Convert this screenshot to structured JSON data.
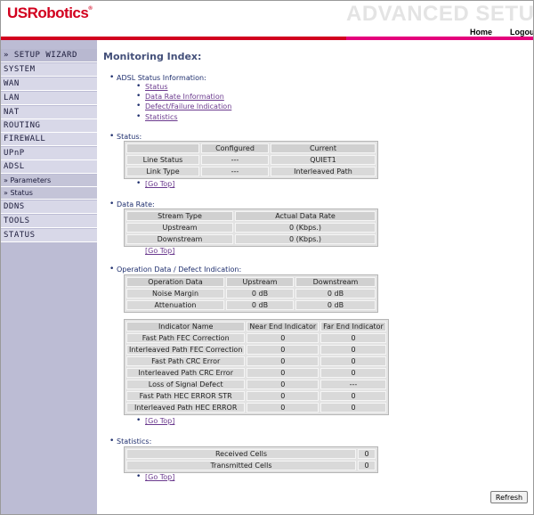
{
  "header": {
    "logo": "USRobotics",
    "logo_reg": "®",
    "banner": "ADVANCED SETU",
    "nav_home": "Home",
    "nav_logout": "Logou"
  },
  "colors": {
    "brand_red": "#d2001e",
    "accent_pink": "#e4007c",
    "sidebar_bg": "#bcbcd4",
    "title_blue": "#44507a"
  },
  "sidebar": {
    "items": [
      {
        "label": "» SETUP WIZARD"
      },
      {
        "label": "SYSTEM"
      },
      {
        "label": "WAN"
      },
      {
        "label": "LAN"
      },
      {
        "label": "NAT"
      },
      {
        "label": "ROUTING"
      },
      {
        "label": "FIREWALL"
      },
      {
        "label": "UPnP"
      },
      {
        "label": "ADSL"
      },
      {
        "label": "» Parameters"
      },
      {
        "label": "» Status"
      },
      {
        "label": "DDNS"
      },
      {
        "label": "TOOLS"
      },
      {
        "label": "STATUS"
      }
    ]
  },
  "main": {
    "title": "Monitoring Index:",
    "index": {
      "heading": "ADSL Status Information:",
      "links": [
        "Status",
        "Data Rate Information",
        "Defect/Failure Indication",
        "Statistics"
      ]
    },
    "go_top": "[Go Top]",
    "status": {
      "heading": "Status:",
      "headers": [
        "",
        "Configured",
        "Current"
      ],
      "rows": [
        [
          "Line Status",
          "---",
          "QUIET1"
        ],
        [
          "Link Type",
          "---",
          "Interleaved Path"
        ]
      ]
    },
    "data_rate": {
      "heading": "Data Rate:",
      "headers": [
        "Stream Type",
        "Actual Data Rate"
      ],
      "rows": [
        [
          "Upstream",
          "0 (Kbps.)"
        ],
        [
          "Downstream",
          "0 (Kbps.)"
        ]
      ]
    },
    "operation": {
      "heading": "Operation Data / Defect Indication:",
      "headers": [
        "Operation Data",
        "Upstream",
        "Downstream"
      ],
      "rows": [
        [
          "Noise Margin",
          "0 dB",
          "0 dB"
        ],
        [
          "Attenuation",
          "0 dB",
          "0 dB"
        ]
      ]
    },
    "indicator": {
      "headers": [
        "Indicator Name",
        "Near End Indicator",
        "Far End Indicator"
      ],
      "rows": [
        [
          "Fast Path FEC Correction",
          "0",
          "0"
        ],
        [
          "Interleaved Path FEC Correction",
          "0",
          "0"
        ],
        [
          "Fast Path CRC Error",
          "0",
          "0"
        ],
        [
          "Interleaved Path CRC Error",
          "0",
          "0"
        ],
        [
          "Loss of Signal Defect",
          "0",
          "---"
        ],
        [
          "Fast Path HEC ERROR STR",
          "0",
          "0"
        ],
        [
          "Interleaved Path HEC ERROR",
          "0",
          "0"
        ]
      ]
    },
    "statistics": {
      "heading": "Statistics:",
      "rows": [
        [
          "Received Cells",
          "0"
        ],
        [
          "Transmitted Cells",
          "0"
        ]
      ]
    },
    "refresh_label": "Refresh"
  }
}
